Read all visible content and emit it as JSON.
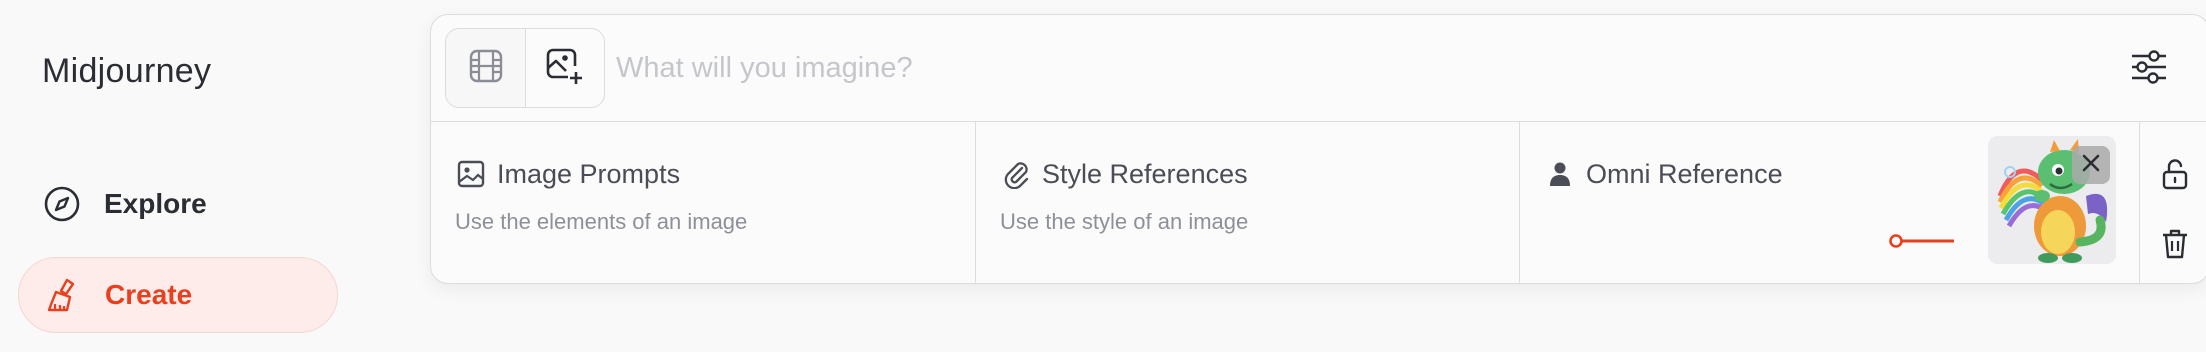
{
  "app": {
    "brand": "Midjourney"
  },
  "nav": {
    "explore": {
      "label": "Explore",
      "icon": "compass-icon"
    },
    "create": {
      "label": "Create",
      "icon": "brush-icon",
      "accent": "#e8401f"
    }
  },
  "prompt": {
    "placeholder": "What will you imagine?",
    "value": "",
    "modes": [
      "film-icon",
      "image-add-icon"
    ],
    "settings_icon": "sliders-icon"
  },
  "references": {
    "image_prompts": {
      "title": "Image Prompts",
      "description": "Use the elements of an image",
      "icon": "image-icon"
    },
    "style_references": {
      "title": "Style References",
      "description": "Use the style of an image",
      "icon": "paperclip-icon"
    },
    "omni_reference": {
      "title": "Omni Reference",
      "icon": "person-icon",
      "thumbnail": "dragon-image",
      "remove_icon": "close-icon"
    }
  },
  "actions": {
    "lock": "unlock-icon",
    "clear": "trash-icon"
  }
}
